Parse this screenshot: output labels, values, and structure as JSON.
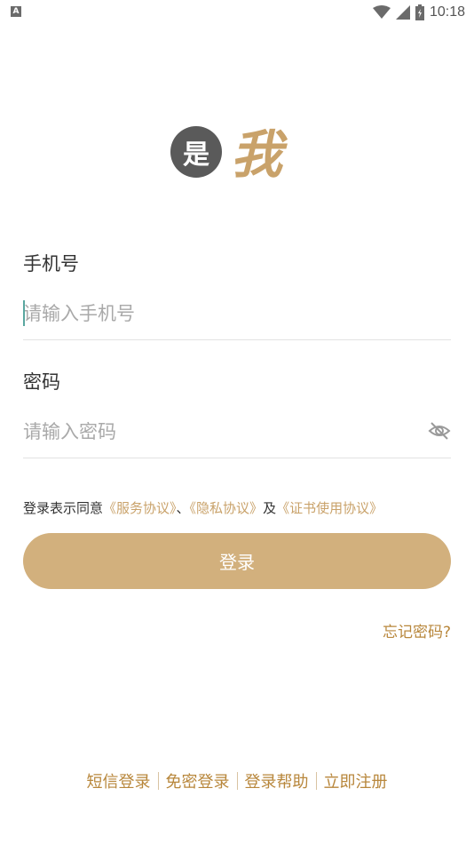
{
  "status_bar": {
    "notification_badge": "A",
    "time": "10:18"
  },
  "logo": {
    "circle_char": "是",
    "char": "我"
  },
  "form": {
    "phone_label": "手机号",
    "phone_placeholder": "请输入手机号",
    "password_label": "密码",
    "password_placeholder": "请输入密码"
  },
  "agreement": {
    "prefix": "登录表示同意",
    "service": "《服务协议》",
    "sep": "、",
    "privacy": "《隐私协议》",
    "and": "及",
    "certificate": "《证书使用协议》"
  },
  "login_button": "登录",
  "forgot_password": "忘记密码?",
  "bottom_links": {
    "sms_login": "短信登录",
    "passwordless_login": "免密登录",
    "login_help": "登录帮助",
    "register": "立即注册"
  },
  "colors": {
    "accent": "#d2b07d",
    "link": "#c9a26a",
    "link_dark": "#b8873c"
  }
}
